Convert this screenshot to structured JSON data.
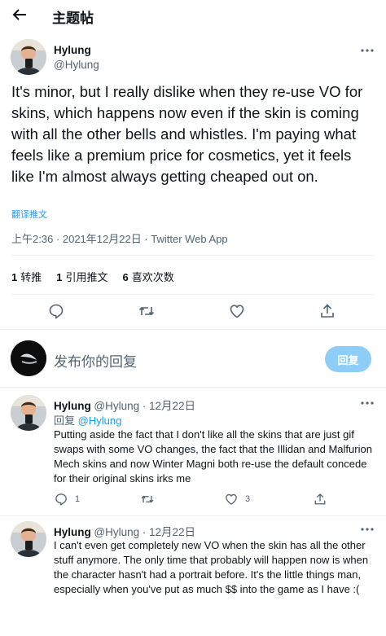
{
  "header": {
    "title": "主题帖"
  },
  "tweet": {
    "name": "Hylung",
    "handle": "@Hylung",
    "text": "It's minor, but I really dislike when they re-use VO for skins, which happens now even if the skin is coming with all the other bells and whistles. I'm paying what feels like a premium price for cosmetics, yet it feels like I'm almost always getting cheaped out on.",
    "translate": "翻译推文",
    "meta": "上午2:36 · 2021年12月22日 · Twitter Web App",
    "stats": [
      {
        "count": "1",
        "label": "转推"
      },
      {
        "count": "1",
        "label": "引用推文"
      },
      {
        "count": "6",
        "label": "喜欢次数"
      }
    ]
  },
  "compose": {
    "placeholder": "发布你的回复",
    "button": "回复"
  },
  "replies": [
    {
      "name": "Hylung",
      "handle": "@Hylung",
      "date": "· 12月22日",
      "reply_prefix": "回复",
      "reply_to": "@Hylung",
      "text": "Putting aside the fact that I don't like all the skins that are just gif swaps with some VO changes, the fact that the Illidan and Malfurion Mech skins and now Winter Magni both re-use the default concede for their original skins irks me",
      "reply_count": "1",
      "like_count": "3"
    },
    {
      "name": "Hylung",
      "handle": "@Hylung",
      "date": "· 12月22日",
      "text": "I can't even get completely new VO when the skin has all the other stuff anymore. The only time that probably will happen now is when the character hasn't had a portrait before. It's the little things man, especially when you've put as much $$ into the game as I have :("
    }
  ],
  "icons": {
    "back": "arrow-left-icon",
    "more": "more-dots-icon",
    "reply": "comment-icon",
    "retweet": "retweet-icon",
    "like": "heart-icon",
    "share": "share-icon"
  },
  "colors": {
    "accent": "#1d9bf0",
    "button_disabled": "#8ecdf8",
    "muted": "#536471"
  }
}
